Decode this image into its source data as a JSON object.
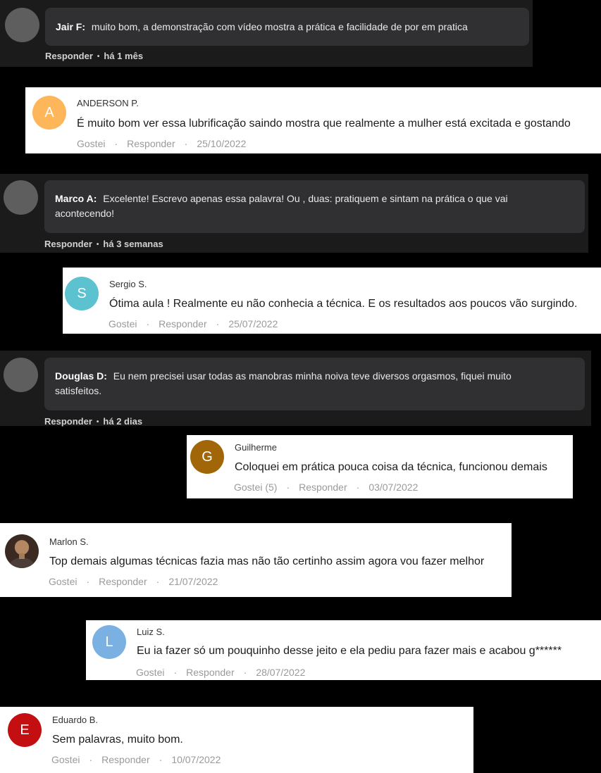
{
  "comments": [
    {
      "author": "Jair F:",
      "text": "muito bom, a demonstração com vídeo mostra a prática e facilidade de por em pratica",
      "reply": "Responder",
      "time": "há 1 mês"
    },
    {
      "initial": "A",
      "avatar_color": "#fdb65a",
      "author": "ANDERSON P.",
      "text": "É muito bom ver essa lubrificação saindo mostra que realmente a mulher está excitada e gostando",
      "like": "Gostei",
      "reply": "Responder",
      "date": "25/10/2022"
    },
    {
      "author": "Marco A:",
      "text_line1": "Excelente! Escrevo apenas essa palavra! Ou , duas: pratiquem e sintam na prática o que vai",
      "text_line2": "acontecendo!",
      "reply": "Responder",
      "time": "há 3 semanas"
    },
    {
      "initial": "S",
      "avatar_color": "#5dc2cf",
      "author": "Sergio S.",
      "text": "Ótima aula ! Realmente eu não conhecia a técnica. E os resultados aos poucos vão surgindo.",
      "like": "Gostei",
      "reply": "Responder",
      "date": "25/07/2022"
    },
    {
      "author": "Douglas D:",
      "text_line1": "Eu nem precisei usar todas as manobras minha noiva teve diversos orgasmos, fiquei muito",
      "text_line2": "satisfeitos.",
      "reply": "Responder",
      "time": "há 2 dias"
    },
    {
      "initial": "G",
      "avatar_color": "#a16608",
      "author": "Guilherme",
      "text": "Coloquei em prática pouca coisa da técnica, funcionou demais",
      "like": "Gostei (5)",
      "reply": "Responder",
      "date": "03/07/2022"
    },
    {
      "author": "Marlon S.",
      "text": "Top demais algumas técnicas fazia mas não tão certinho assim agora vou fazer melhor",
      "like": "Gostei",
      "reply": "Responder",
      "date": "21/07/2022"
    },
    {
      "initial": "L",
      "avatar_color": "#7ab1e2",
      "author": "Luiz S.",
      "text": "Eu ia fazer só um pouquinho desse jeito e ela pediu para fazer mais e acabou g******",
      "like": "Gostei",
      "reply": "Responder",
      "date": "28/07/2022"
    },
    {
      "initial": "E",
      "avatar_color": "#c40f12",
      "author": "Eduardo B.",
      "text": "Sem palavras, muito bom.",
      "like": "Gostei",
      "reply": "Responder",
      "date": "10/07/2022"
    }
  ],
  "separator": "·",
  "meta_dot": "•"
}
